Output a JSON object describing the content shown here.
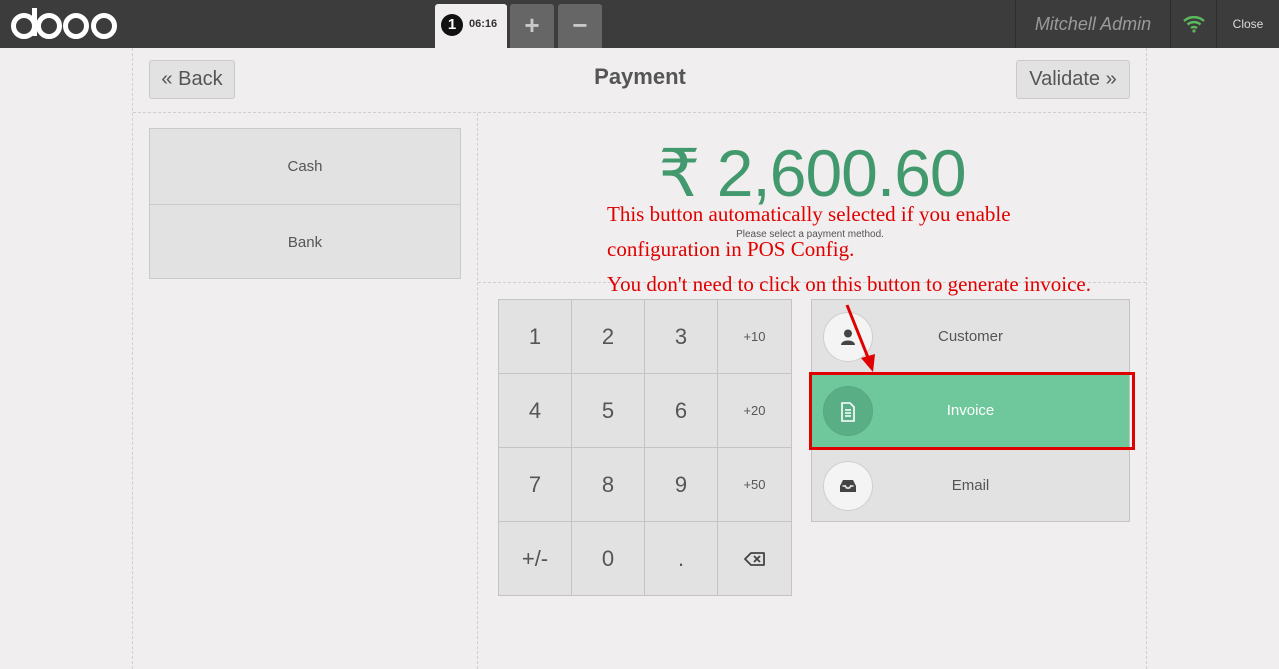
{
  "topbar": {
    "logo": "odoo",
    "order": {
      "number": "1",
      "time": "06:16"
    },
    "add_order_label": "+",
    "remove_order_label": "−",
    "user": "Mitchell Admin",
    "close_label": "Close",
    "wifi_color": "#5cb85c"
  },
  "header": {
    "back_label": "« Back",
    "title": "Payment",
    "validate_label": "Validate »"
  },
  "payment_methods": [
    "Cash",
    "Bank"
  ],
  "summary": {
    "total": "₹ 2,600.60",
    "hint": "Please select a payment method."
  },
  "numpad": {
    "keys": [
      "1",
      "2",
      "3",
      "+10",
      "4",
      "5",
      "6",
      "+20",
      "7",
      "8",
      "9",
      "+50",
      "+/-",
      "0",
      "."
    ],
    "backspace_icon": "backspace-icon"
  },
  "actions": {
    "customer": {
      "label": "Customer",
      "icon": "user-icon"
    },
    "invoice": {
      "label": "Invoice",
      "icon": "file-text-icon",
      "selected": true
    },
    "email": {
      "label": "Email",
      "icon": "inbox-icon"
    }
  },
  "annotation": {
    "line1": "This button automatically selected if you enable",
    "line2": "configuration in POS Config.",
    "line3": "You don't need to click on this button to generate invoice.",
    "color": "#e00000"
  },
  "colors": {
    "accent": "#43996e",
    "selected_action": "#6ec89b",
    "topbar": "#3c3c3c"
  }
}
